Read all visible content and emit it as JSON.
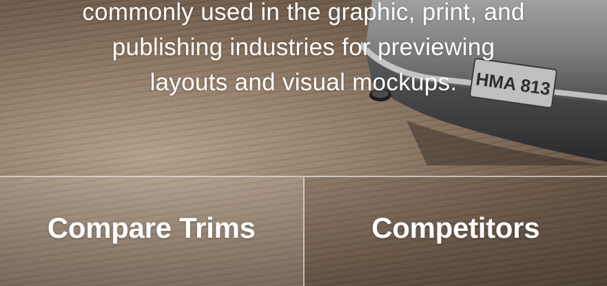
{
  "hero": {
    "description_lines": [
      "commonly used in the graphic, print, and",
      "publishing industries for previewing",
      "layouts and visual mockups."
    ],
    "license_plate": "HMA 813"
  },
  "nav_tiles": [
    {
      "label": "Compare Trims"
    },
    {
      "label": "Competitors"
    }
  ]
}
